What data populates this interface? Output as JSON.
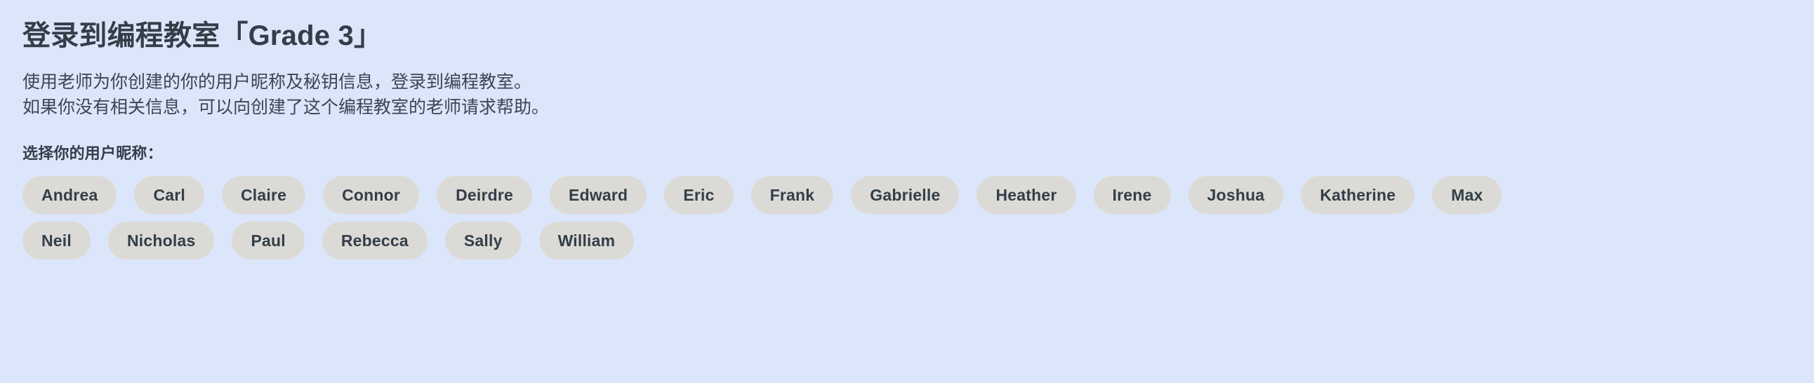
{
  "page": {
    "background_color": "#dce6fb",
    "title": "登录到编程教室「Grade 3」",
    "intro_line_1": "使用老师为你创建的你的用户昵称及秘钥信息，登录到编程教室。",
    "intro_line_2": "如果你没有相关信息，可以向创建了这个编程教室的老师请求帮助。",
    "choose_label": "选择你的用户昵称："
  },
  "nicknames": {
    "button_fill_color": "#dcdad6",
    "button_text_color": "#333e48",
    "rows": [
      [
        "Andrea",
        "Carl",
        "Claire",
        "Connor",
        "Deirdre",
        "Edward",
        "Eric",
        "Frank",
        "Gabrielle",
        "Heather",
        "Irene",
        "Joshua",
        "Katherine",
        "Max"
      ],
      [
        "Neil",
        "Nicholas",
        "Paul",
        "Rebecca",
        "Sally",
        "William"
      ]
    ]
  }
}
